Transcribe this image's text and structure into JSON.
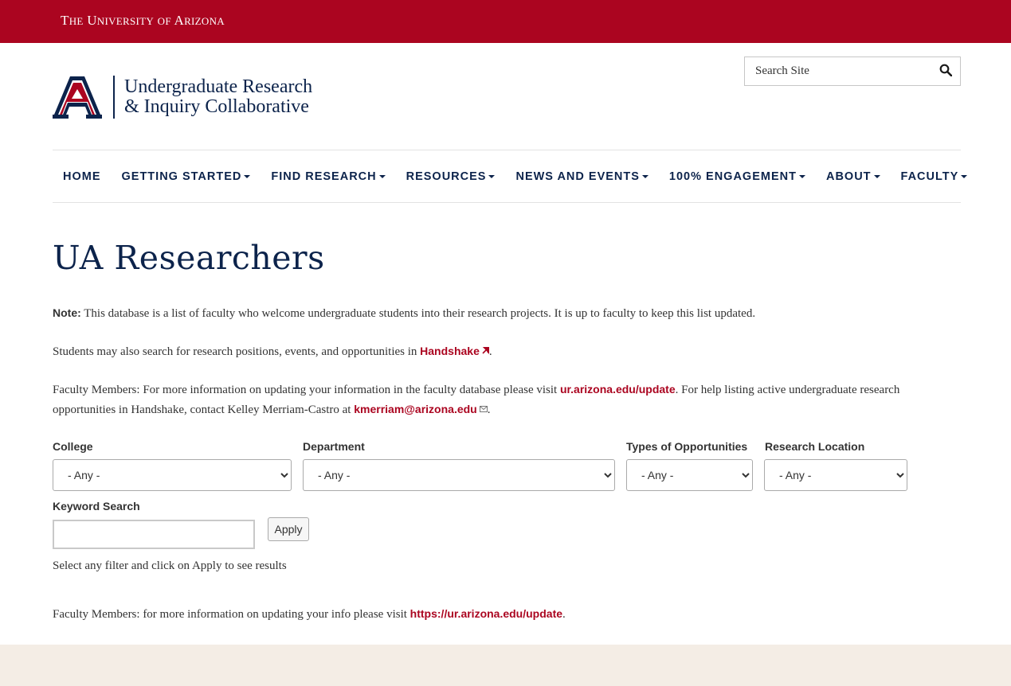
{
  "topbar": {
    "wordmark_the": "T",
    "wordmark_he": "HE",
    "wordmark_u": "U",
    "wordmark_niversity": "NIVERSITY",
    "wordmark_of": "OF",
    "wordmark_a": "A",
    "wordmark_rizona": "RIZONA"
  },
  "logo": {
    "line1": "Undergraduate Research",
    "line2": "& Inquiry Collaborative"
  },
  "search": {
    "placeholder": "Search Site"
  },
  "nav": {
    "items": [
      {
        "label": "HOME",
        "dropdown": false
      },
      {
        "label": "GETTING STARTED",
        "dropdown": true
      },
      {
        "label": "FIND RESEARCH",
        "dropdown": true
      },
      {
        "label": "RESOURCES",
        "dropdown": true
      },
      {
        "label": "NEWS AND EVENTS",
        "dropdown": true
      },
      {
        "label": "100% ENGAGEMENT",
        "dropdown": true
      },
      {
        "label": "ABOUT",
        "dropdown": true
      },
      {
        "label": "FACULTY",
        "dropdown": true
      }
    ]
  },
  "page": {
    "title": "UA Researchers",
    "note_label": "Note:",
    "note_text": " This database is a list of faculty who welcome undergraduate students into their research projects. It is up to faculty to keep this list updated.",
    "students_text": "Students may also search for research positions, events, and opportunities in ",
    "handshake_link": "Handshake",
    "period": ".",
    "faculty_text1": "Faculty Members: For more information on updating your information in the faculty database please visit ",
    "faculty_link1": "ur.arizona.edu/update",
    "faculty_text2": ". For help listing active undergraduate research opportunities in Handshake, contact Kelley Merriam-Castro at ",
    "email_link": "kmerriam@arizona.edu",
    "faculty_text3": "."
  },
  "filters": {
    "college": {
      "label": "College",
      "value": "- Any -"
    },
    "department": {
      "label": "Department",
      "value": "- Any -"
    },
    "types": {
      "label": "Types of Opportunities",
      "value": "- Any -"
    },
    "location": {
      "label": "Research Location",
      "value": "- Any -"
    },
    "keyword": {
      "label": "Keyword Search",
      "value": ""
    },
    "apply_label": "Apply",
    "hint": "Select any filter and click on Apply to see results"
  },
  "footer_note": {
    "text": "Faculty Members: for more information on updating your info please visit ",
    "link": "https://ur.arizona.edu/update",
    "period": "."
  },
  "colors": {
    "brand_red": "#AB0520",
    "brand_navy": "#0C234B",
    "footer_bg": "#f4ede5"
  }
}
